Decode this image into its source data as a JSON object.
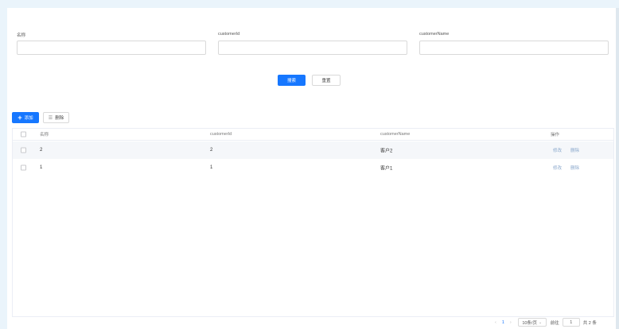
{
  "search": {
    "fields": [
      {
        "label": "名称",
        "value": "",
        "placeholder": ""
      },
      {
        "label": "customerId",
        "value": "",
        "placeholder": ""
      },
      {
        "label": "customerName",
        "value": "",
        "placeholder": ""
      }
    ],
    "search_label": "搜索",
    "reset_label": "重置"
  },
  "toolbar": {
    "add_label": "添加",
    "delete_label": "删除"
  },
  "table": {
    "columns": [
      "名称",
      "customerId",
      "customerName",
      "操作"
    ],
    "rows": [
      {
        "name": "2",
        "customerId": "2",
        "customerName": "客户2",
        "edit": "修改",
        "delete": "删除"
      },
      {
        "name": "1",
        "customerId": "1",
        "customerName": "客户1",
        "edit": "修改",
        "delete": "删除"
      }
    ]
  },
  "pagination": {
    "prev": "‹",
    "current_page": "1",
    "next": "›",
    "page_size": "10条/页",
    "jump_label": "前往",
    "jump_value": "1",
    "total": "共 2 条"
  },
  "colors": {
    "primary": "#1677ff",
    "background": "#eaf4fb",
    "link": "#8aa8cc"
  }
}
